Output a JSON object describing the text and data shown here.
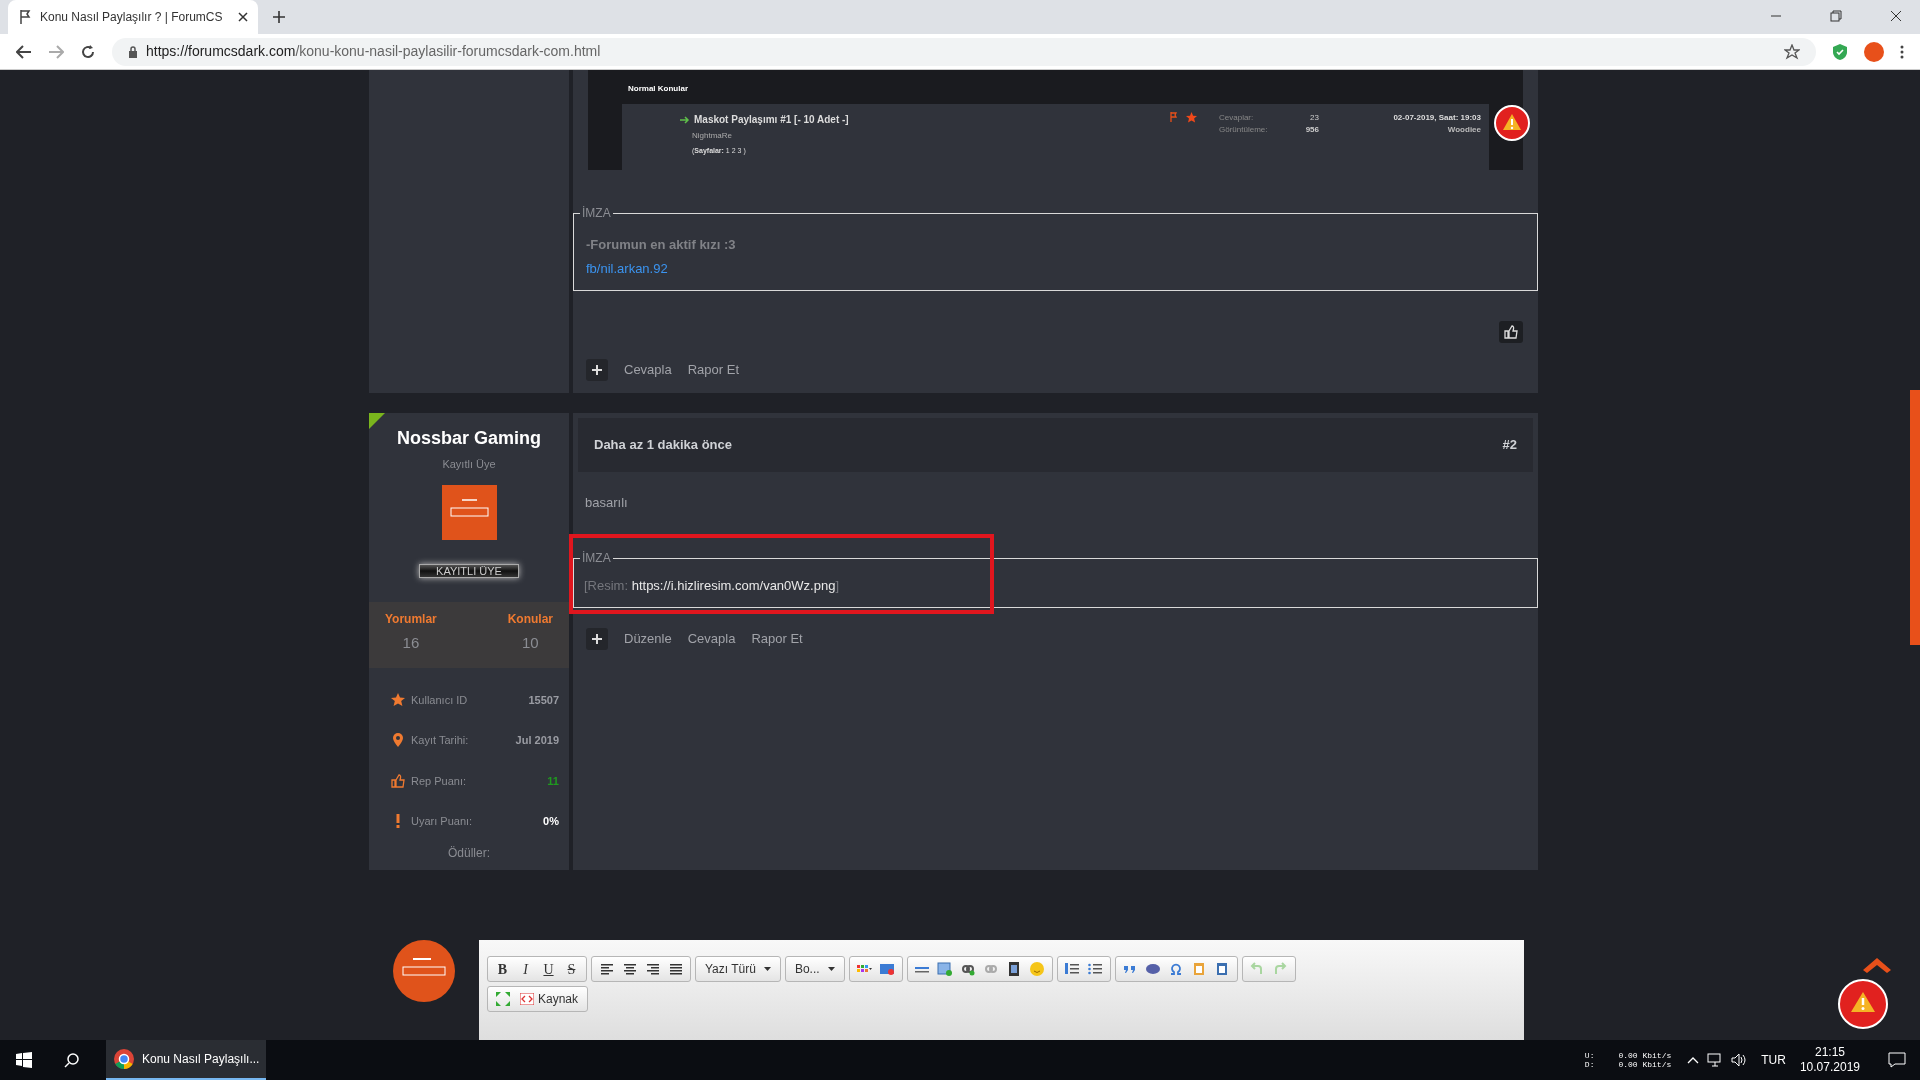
{
  "browser": {
    "tab_title": "Konu Nasıl Paylaşılır ? | ForumCS",
    "url_domain": "https://forumcsdark.com",
    "url_path": "/konu-konu-nasil-paylasilir-forumcsdark-com.html"
  },
  "first_post": {
    "embedded_screenshot": {
      "section": "Normal Konular",
      "thread_title": "Maskot Paylaşımı #1 [- 10 Adet -]",
      "author": "NightmaRe",
      "pages": "(**Sayfalar:** 1 2 3 )",
      "replies_label": "Cevaplar:",
      "replies": "23",
      "views_label": "Görüntüleme:",
      "views": "956",
      "date": "02-07-2019, Saat: 19:03",
      "last_poster": "Woodiee"
    },
    "signature": {
      "legend": "İMZA",
      "lines": [
        {
          "kind": "text",
          "text": "-Forumun en aktif kızı :3"
        },
        {
          "kind": "link",
          "text": "fb/nil.arkan.92"
        }
      ]
    },
    "actions": [
      "Cevapla",
      "Rapor Et"
    ]
  },
  "second_post": {
    "user": {
      "name": "Nossbar Gaming",
      "role": "Kayıtlı Üye",
      "rank_badge": "KAYITLI ÜYE",
      "stats": [
        {
          "label": "Yorumlar",
          "value": "16"
        },
        {
          "label": "Konular",
          "value": "10"
        }
      ],
      "info": [
        {
          "kind": "star",
          "label": "Kullanıcı ID",
          "value": "15507",
          "color": "#9a9ca3"
        },
        {
          "kind": "pin",
          "label": "Kayıt Tarihi:",
          "value": "Jul 2019",
          "color": "#9a9ca3"
        },
        {
          "kind": "thumb",
          "label": "Rep Puanı:",
          "value": "11",
          "color": "#1f9a1f"
        },
        {
          "kind": "alert",
          "label": "Uyarı Puanı:",
          "value": "0%",
          "color": "#ffffff"
        }
      ],
      "awards_label": "Ödüller:"
    },
    "time": "Daha az 1 dakika önce",
    "number": "#2",
    "body": "basarılı",
    "signature": {
      "legend": "İMZA",
      "prefix": "[Resim: ",
      "link": "https://i.hizliresim.com/van0Wz.png",
      "suffix": "]",
      "highlighted": true
    },
    "actions": [
      "Düzenle",
      "Cevapla",
      "Rapor Et"
    ]
  },
  "editor": {
    "format_buttons": [
      "B",
      "I",
      "U",
      "S"
    ],
    "dropdowns": [
      "Yazı Türü",
      "Bo..."
    ],
    "source_button": "Kaynak",
    "history_buttons": [
      {
        "disabled": true
      },
      {
        "disabled": true
      }
    ]
  },
  "taskbar": {
    "window_button": "Konu Nasıl Paylaşılı...",
    "net_labels": [
      "U:",
      "D:"
    ],
    "net_speeds": [
      "0.00 Kbit/s",
      "0.00 Kbit/s"
    ],
    "language": "TUR",
    "time": "21:15",
    "date": "10.07.2019"
  }
}
